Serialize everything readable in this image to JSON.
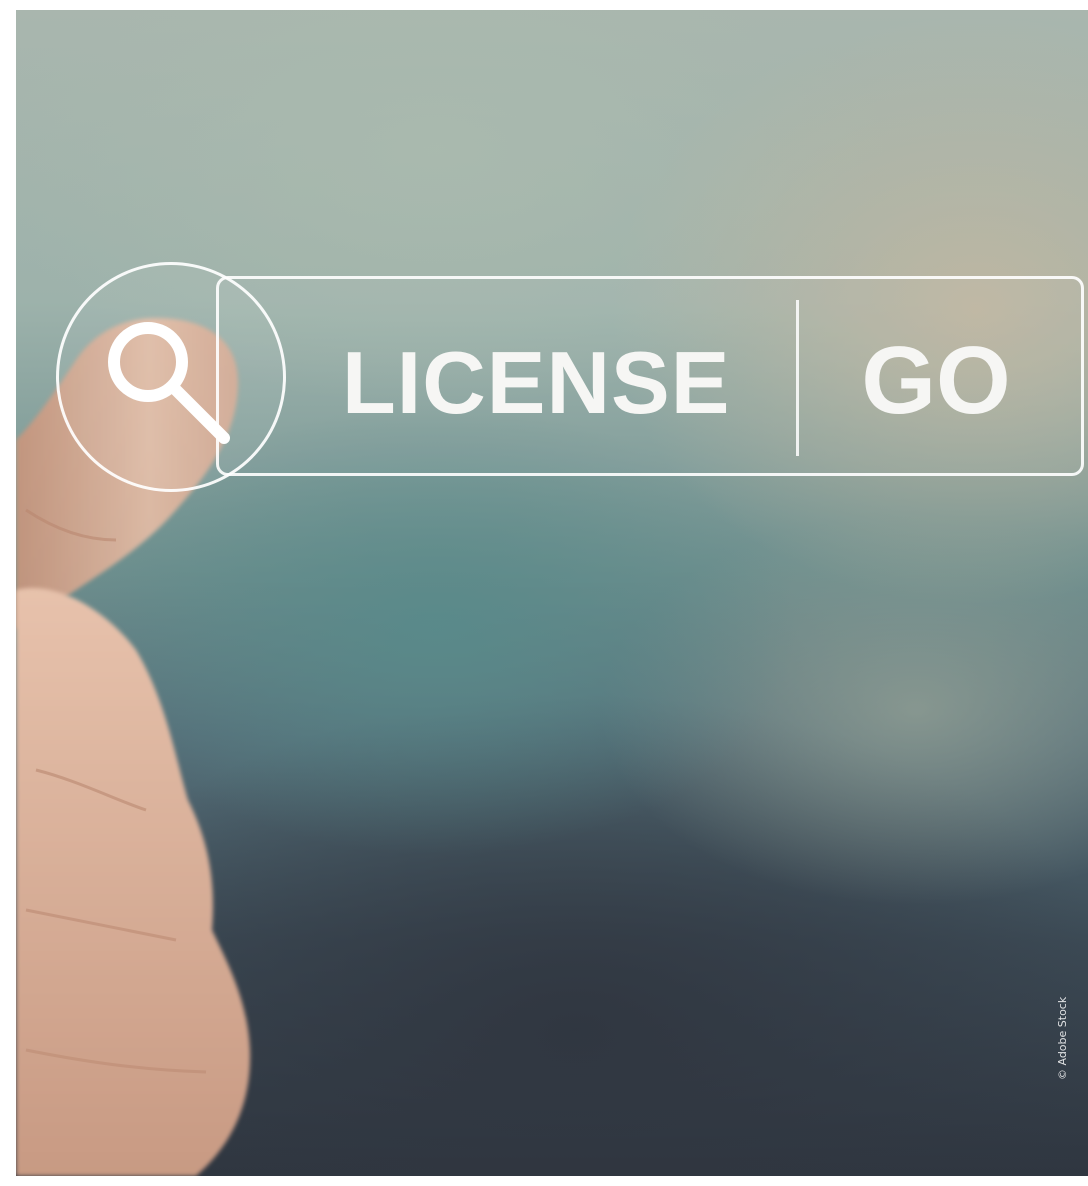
{
  "search": {
    "query": "LICENSE",
    "button_label": "GO"
  },
  "credit": "© Adobe Stock",
  "icons": {
    "search": "magnifier-icon"
  },
  "colors": {
    "overlay_white": "#ffffff",
    "bg_top": "#a9b6ae",
    "bg_mid_teal": "#6e8f8e",
    "bg_bottom": "#2f3640",
    "skin": "#e2b8a0"
  }
}
